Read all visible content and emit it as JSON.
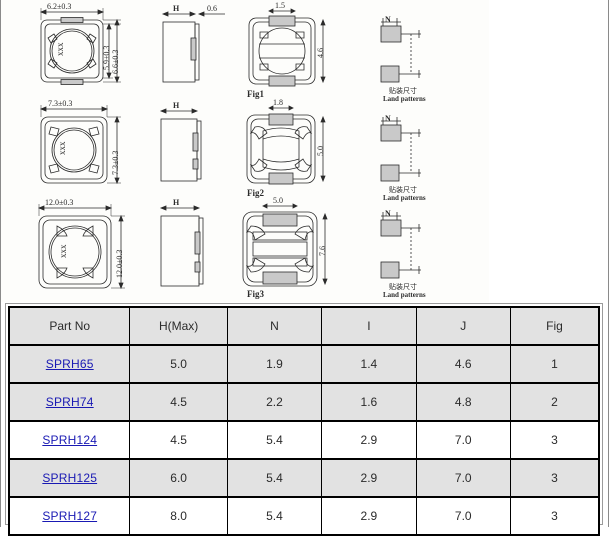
{
  "drawings": {
    "figures": [
      {
        "id": "fig1",
        "caption": "Fig1",
        "top_width": "6.2±0.3",
        "inner_height": "5.9±0.3",
        "outer_height": "6.6±0.3",
        "side_h": "H",
        "side_pad": "0.6",
        "bottom_pad_width": "1.5",
        "bottom_pad_height": "4.6",
        "body_mark": "xxx",
        "land_n": "N",
        "land_caption_cn": "贴装尺寸",
        "land_caption_en": "Land patterns"
      },
      {
        "id": "fig2",
        "caption": "Fig2",
        "top_width": "7.3±0.3",
        "outer_height": "7.3±0.3",
        "side_h": "H",
        "bottom_pad_width": "1.8",
        "bottom_pad_height": "5.0",
        "body_mark": "xxx",
        "land_n": "N",
        "land_caption_cn": "贴装尺寸",
        "land_caption_en": "Land patterns"
      },
      {
        "id": "fig3",
        "caption": "Fig3",
        "top_width": "12.0±0.3",
        "outer_height": "12.0±0.3",
        "side_h": "H",
        "bottom_pad_width": "5.0",
        "bottom_pad_height": "7.6",
        "body_mark": "xxx",
        "land_n": "N",
        "land_caption_cn": "贴装尺寸",
        "land_caption_en": "Land patterns"
      }
    ]
  },
  "spec_table": {
    "headers": [
      "Part No",
      "H(Max)",
      "N",
      "I",
      "J",
      "Fig"
    ],
    "rows": [
      {
        "part": "SPRH65",
        "h": "5.0",
        "n": "1.9",
        "i": "1.4",
        "j": "4.6",
        "fig": "1",
        "shaded": true
      },
      {
        "part": "SPRH74",
        "h": "4.5",
        "n": "2.2",
        "i": "1.6",
        "j": "4.8",
        "fig": "2",
        "shaded": true
      },
      {
        "part": "SPRH124",
        "h": "4.5",
        "n": "5.4",
        "i": "2.9",
        "j": "7.0",
        "fig": "3",
        "shaded": false
      },
      {
        "part": "SPRH125",
        "h": "6.0",
        "n": "5.4",
        "i": "2.9",
        "j": "7.0",
        "fig": "3",
        "shaded": true
      },
      {
        "part": "SPRH127",
        "h": "8.0",
        "n": "5.4",
        "i": "2.9",
        "j": "7.0",
        "fig": "3",
        "shaded": false
      }
    ]
  },
  "colors": {
    "link": "#1919b3",
    "row_shade": "#e2e2e2",
    "line": "#2b2b2b",
    "pad_fill": "#c9c9c9"
  }
}
